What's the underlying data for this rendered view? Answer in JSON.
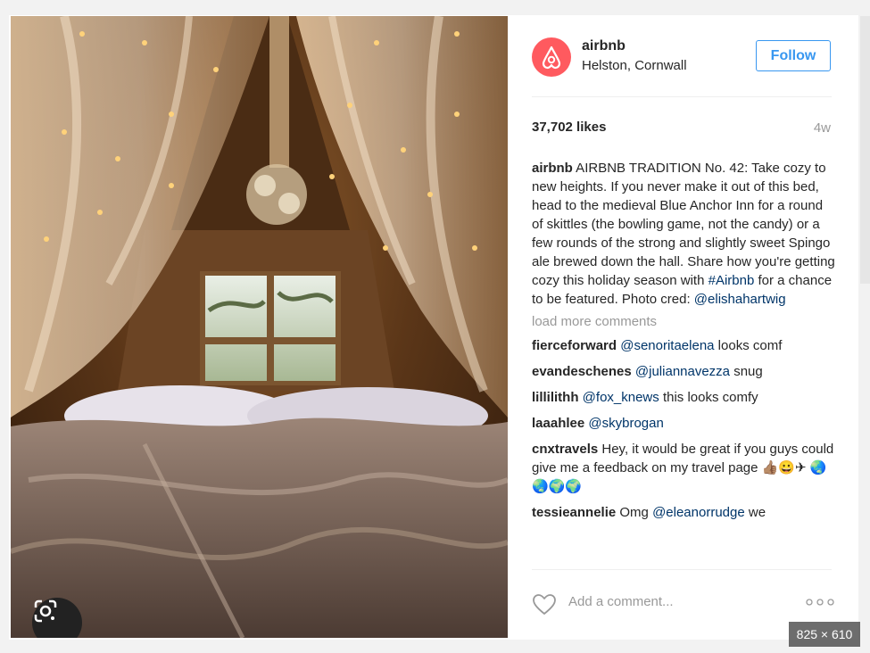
{
  "post": {
    "username": "airbnb",
    "location": "Helston, Cornwall",
    "follow_label": "Follow",
    "likes": "37,702 likes",
    "age": "4w",
    "caption": {
      "user": "airbnb",
      "text_1": " AIRBNB TRADITION No. 42: Take cozy to new heights. If you never make it out of this bed, head to the medieval Blue Anchor Inn for a round of skittles (the bowling game, not the candy) or a few rounds of the strong and slightly sweet Spingo ale brewed down the hall. Share how you're getting cozy this holiday season with ",
      "hashtag": "#Airbnb",
      "text_2": " for a chance to be featured. Photo cred: ",
      "mention": "@elishahartwig"
    },
    "load_more": "load more comments",
    "comments": [
      {
        "user": "fierceforward",
        "mention": "@senoritaelena",
        "text": " looks comf"
      },
      {
        "user": "evandeschenes",
        "mention": "@juliannavezza",
        "text": " snug"
      },
      {
        "user": "lillilithh",
        "mention": "@fox_knews",
        "text": " this looks comfy"
      },
      {
        "user": "laaahlee",
        "mention": "@skybrogan",
        "text": ""
      },
      {
        "user": "cnxtravels",
        "mention": "",
        "text": " Hey, it would be great if you guys could give me a feedback on my travel page 👍🏽😀✈ 🌏🌏🌍🌍"
      },
      {
        "user": "tessieannelie",
        "mention": "",
        "text": " Omg "
      },
      {
        "user": "",
        "mention": "@eleanorrudge",
        "text": " we"
      }
    ],
    "add_comment_placeholder": "Add a comment...",
    "image_size": "825 × 610"
  },
  "icons": {
    "avatar": "airbnb-logo-icon",
    "lens": "google-lens-icon",
    "heart": "heart-icon",
    "more": "more-options-icon"
  },
  "colors": {
    "brand": "#ff5a5f",
    "link": "#003569",
    "follow": "#3897f0",
    "muted": "#999999"
  }
}
